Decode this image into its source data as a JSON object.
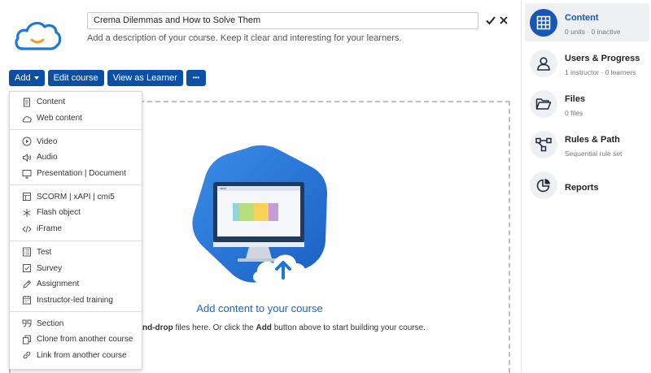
{
  "header": {
    "course_title": "Crema Dilemmas and How to Solve Them",
    "description": "Add a description of your course. Keep it clear and interesting for your learners."
  },
  "toolbar": {
    "add_label": "Add",
    "edit_label": "Edit course",
    "view_label": "View as Learner",
    "more_label": "•••"
  },
  "menu": {
    "groups": [
      [
        {
          "label": "Content",
          "icon": "document-icon"
        },
        {
          "label": "Web content",
          "icon": "cloud-icon"
        }
      ],
      [
        {
          "label": "Video",
          "icon": "play-circle-icon"
        },
        {
          "label": "Audio",
          "icon": "speaker-icon"
        },
        {
          "label": "Presentation | Document",
          "icon": "presentation-icon"
        }
      ],
      [
        {
          "label": "SCORM | xAPI | cmi5",
          "icon": "scorm-icon"
        },
        {
          "label": "Flash object",
          "icon": "asterisk-icon"
        },
        {
          "label": "iFrame",
          "icon": "code-icon"
        }
      ],
      [
        {
          "label": "Test",
          "icon": "test-icon"
        },
        {
          "label": "Survey",
          "icon": "checkbox-icon"
        },
        {
          "label": "Assignment",
          "icon": "pen-icon"
        },
        {
          "label": "Instructor-led training",
          "icon": "calendar-icon"
        }
      ],
      [
        {
          "label": "Section",
          "icon": "quote-icon"
        },
        {
          "label": "Clone from another course",
          "icon": "copy-icon"
        },
        {
          "label": "Link from another course",
          "icon": "link-icon"
        }
      ]
    ]
  },
  "dropzone": {
    "title": "Add content to your course",
    "hint_bold1": "g-and-drop",
    "hint_mid": " files here. Or click the ",
    "hint_bold2": "Add",
    "hint_end": " button above to start building your course."
  },
  "panel": {
    "items": [
      {
        "title": "Content",
        "subtitle": "0 units · 0 inactive",
        "icon": "grid-icon",
        "active": true
      },
      {
        "title": "Users & Progress",
        "subtitle": "1 instructor · 0 learners",
        "icon": "user-icon",
        "active": false
      },
      {
        "title": "Files",
        "subtitle": "0 files",
        "icon": "folder-icon",
        "active": false
      },
      {
        "title": "Rules & Path",
        "subtitle": "Sequential rule set",
        "icon": "path-icon",
        "active": false
      },
      {
        "title": "Reports",
        "subtitle": "",
        "icon": "pie-chart-icon",
        "active": false
      }
    ]
  },
  "colors": {
    "primary": "#0c4fa7",
    "active_panel": "#1756b3",
    "link_blue": "#1464c8",
    "logo_blue": "#1f78d1",
    "logo_orange": "#f39c33"
  }
}
